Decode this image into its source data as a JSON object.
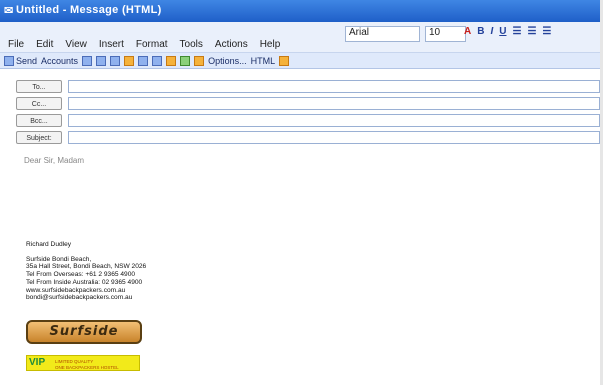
{
  "window": {
    "title": "Untitled - Message (HTML)"
  },
  "menu": {
    "items": [
      "File",
      "Edit",
      "View",
      "Insert",
      "Format",
      "Tools",
      "Actions",
      "Help"
    ]
  },
  "format": {
    "font": "Arial",
    "size": "10"
  },
  "toolbar": {
    "send": "Send",
    "accounts": "Accounts",
    "options": "Options...",
    "html": "HTML"
  },
  "address": {
    "to": "To...",
    "cc": "Cc...",
    "bcc": "Bcc...",
    "subject": "Subject:"
  },
  "body": {
    "greeting": "Dear Sir, Madam",
    "signature": {
      "name": "Richard Dudley",
      "business": "Surfside Bondi Beach,",
      "address": "35a Hall Street, Bondi Beach, NSW 2026",
      "tel_overseas": "Tel From Overseas: +61 2 9365 4900",
      "tel_inside": "Tel From Inside Australia: 02 9365 4900",
      "website": "www.surfsidebackpackers.com.au",
      "email": "bondi@surfsidebackpackers.com.au"
    }
  },
  "logos": {
    "surfside": "Surfside",
    "vip_mark": "VIP",
    "vip_line1": "LIMITED QUALITY",
    "vip_line2": "ONE BACKPACKERS HOSTEL"
  },
  "icons": [
    "envelope-icon",
    "send-icon",
    "save-icon",
    "attach-icon",
    "address-book-icon",
    "check-names-icon",
    "importance-icon",
    "flag-icon",
    "options-icon",
    "format-icon",
    "bold-icon",
    "italic-icon",
    "underline-icon",
    "align-icon"
  ]
}
